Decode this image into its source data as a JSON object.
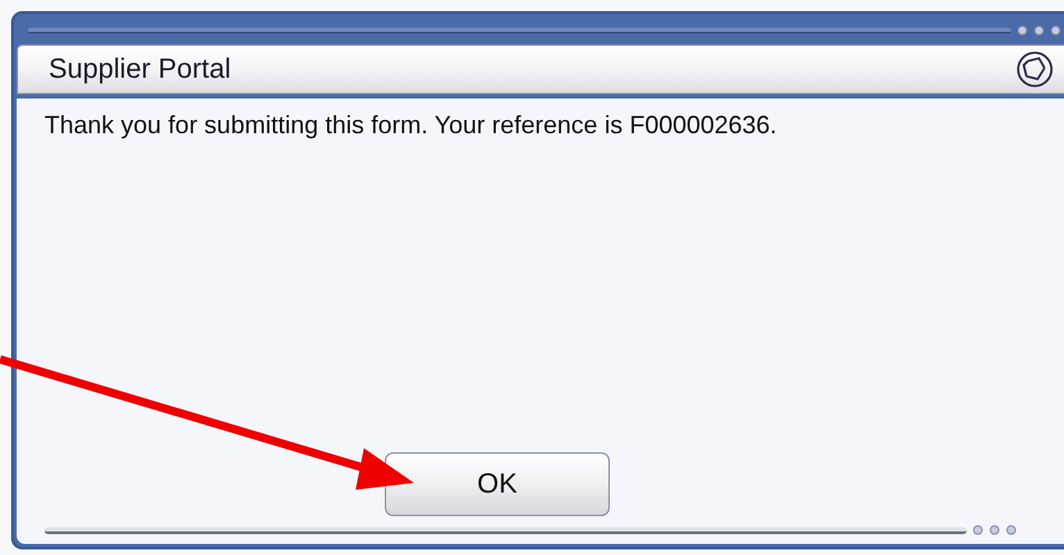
{
  "window": {
    "title": "Supplier Portal"
  },
  "message": "Thank you for submitting this form. Your reference is F000002636.",
  "buttons": [
    "OK"
  ]
}
